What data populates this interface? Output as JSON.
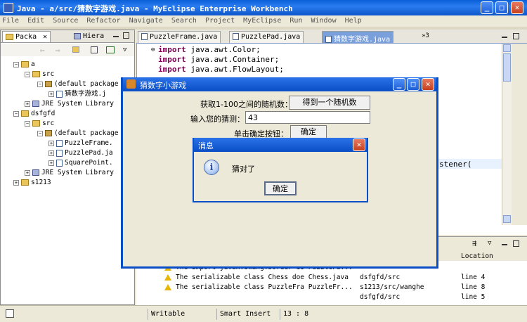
{
  "window": {
    "title": "Java - a/src/猜数字游戏.java - MyEclipse Enterprise Workbench",
    "controls": {
      "minimize": "_",
      "maximize": "□",
      "close": "✕"
    }
  },
  "menu": [
    "File",
    "Edit",
    "Source",
    "Refactor",
    "Navigate",
    "Search",
    "Project",
    "MyEclipse",
    "Run",
    "Window",
    "Help"
  ],
  "left_panel": {
    "tabs": [
      {
        "label": "Packa",
        "close": "✕"
      },
      {
        "label": "Hiera"
      }
    ],
    "tree": [
      {
        "label": "a",
        "expander": "−"
      },
      {
        "label": "src",
        "expander": "−"
      },
      {
        "label": "(default package",
        "expander": "−"
      },
      {
        "label": "猜数字游戏.j",
        "expander": "+"
      },
      {
        "label": "JRE System Library",
        "expander": "+"
      },
      {
        "label": "dsfgfd",
        "expander": "−"
      },
      {
        "label": "src",
        "expander": "−"
      },
      {
        "label": "(default package",
        "expander": "−"
      },
      {
        "label": "PuzzleFrame.",
        "expander": "+"
      },
      {
        "label": "PuzzlePad.ja",
        "expander": "+"
      },
      {
        "label": "SquarePoint.",
        "expander": "+"
      },
      {
        "label": "JRE System Library",
        "expander": "+"
      },
      {
        "label": "s1213",
        "expander": "+"
      }
    ]
  },
  "editor": {
    "tabs": [
      "PuzzleFrame.java",
      "PuzzlePad.java",
      "猜数字游戏.java"
    ],
    "overflow_label": "»3",
    "lines": [
      {
        "kw": "import",
        "rest": " java.awt.Color;"
      },
      {
        "kw": "import",
        "rest": " java.awt.Container;"
      },
      {
        "kw": "import",
        "rest": " java.awt.FlowLayout;"
      }
    ],
    "partial_text": "stener("
  },
  "problems": {
    "column_header": "Location",
    "rows": [
      {
        "desc": "The import javax.swing.border is",
        "resource": "PuzzlePa...",
        "path": "dsfgfd/src",
        "location": "line 4"
      },
      {
        "desc": "The serializable class Chess doe",
        "resource": "Chess.java",
        "path": "s1213/src/wanghe",
        "location": "line 8"
      },
      {
        "desc": "The serializable class PuzzleFra",
        "resource": "PuzzleFr...",
        "path": "dsfgfd/src",
        "location": "line 5"
      }
    ]
  },
  "status": {
    "writable": "Writable",
    "insert_mode": "Smart Insert",
    "position": "13 : 8"
  },
  "game_window": {
    "title": "猜数字小游戏",
    "random_label": "获取1-100之间的随机数：",
    "random_button": "得到一个随机数",
    "guess_label": "输入您的猜测：",
    "guess_value": "43",
    "confirm_label": "单击确定按钮：",
    "confirm_button": "确定"
  },
  "message_dialog": {
    "title": "消息",
    "message": "猜对了",
    "ok_button": "确定",
    "info_glyph": "i"
  }
}
